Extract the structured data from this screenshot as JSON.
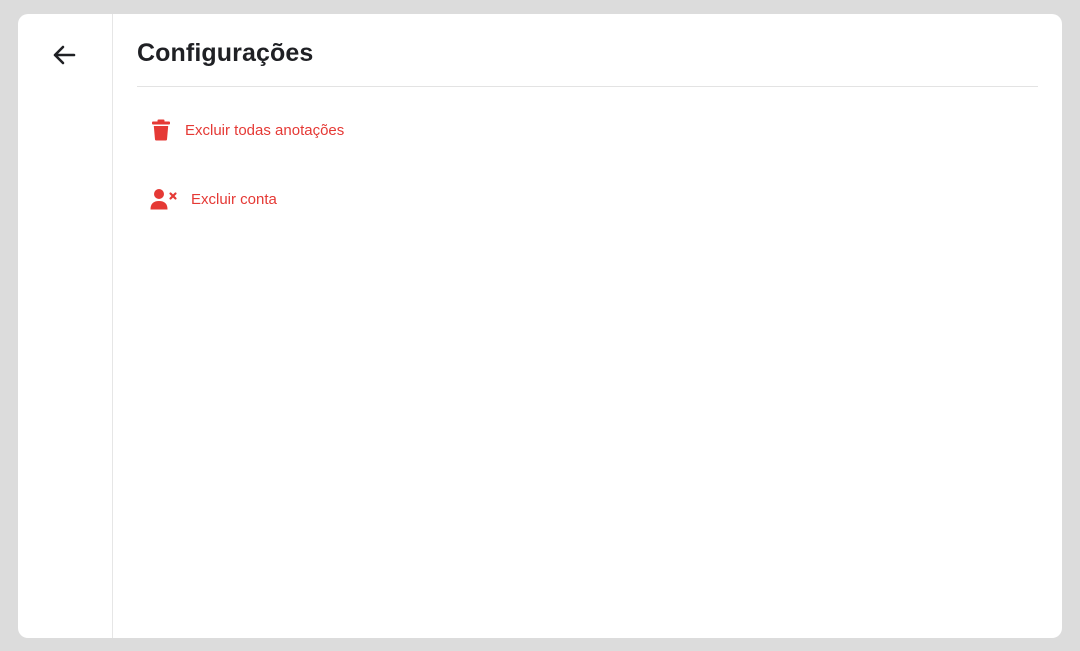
{
  "colors": {
    "background": "#dcdcdc",
    "panel": "#ffffff",
    "danger": "#e53935",
    "title": "#1f2024"
  },
  "sidebar": {
    "back_icon": "arrow-left-icon"
  },
  "header": {
    "title": "Configurações"
  },
  "options": [
    {
      "label": "Excluir todas anotações",
      "icon": "trash-icon"
    },
    {
      "label": "Excluir conta",
      "icon": "user-remove-icon"
    }
  ]
}
